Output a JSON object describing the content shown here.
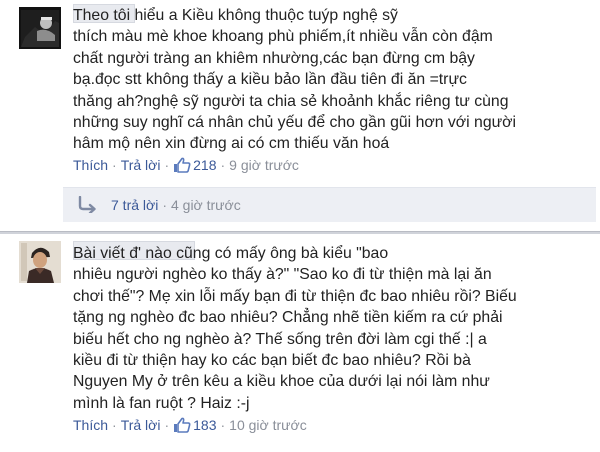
{
  "comments": [
    {
      "text": "Theo tôi hiểu a Kiều không thuộc tuýp nghệ sỹ\nthích màu mè khoe khoang phù phiếm,ít nhiều vẫn còn đậm\nchất người tràng an khiêm nhường,các bạn đừng cm bậy\nbạ.đọc stt không thấy a kiều bảo lần đầu tiên đi ăn =trực\nthăng ah?nghệ sỹ người ta chia sẻ khoảnh khắc riêng tư cùng\nnhững suy nghĩ cá nhân chủ yếu để cho gần gũi hơn với người\nhâm mộ nên xin đừng ai có cm thiếu văn hoá",
      "like_label": "Thích",
      "reply_label": "Trả lời",
      "like_count": "218",
      "time": "9 giờ trước",
      "like_icon": "thumbs-up-icon",
      "replies_summary": {
        "icon": "reply-arrow-icon",
        "count_label": "7 trả lời",
        "time": "4 giờ trước"
      }
    },
    {
      "text": "Bài viết đ' nào cũng có mấy ông bà kiểu \"bao\nnhiêu người nghèo ko thấy à?\" \"Sao ko đi từ thiện mà lại ăn\nchơi thế\"? Mẹ xin lỗi mấy bạn đi từ thiện đc bao nhiêu rồi? Biếu\ntặng ng nghèo đc bao nhiêu? Chẳng nhẽ tiền kiếm ra cứ phải\nbiếu hết cho ng nghèo à? Thế sống trên đời làm cgi thế :| a\nkiều đi từ thiện hay ko các bạn biết đc bao nhiêu? Rồi bà\nNguyen My ở trên kêu a kiều khoe của dưới lại nói làm như\nmình là fan ruột ? Haiz :-j",
      "like_label": "Thích",
      "reply_label": "Trả lời",
      "like_count": "183",
      "time": "10 giờ trước",
      "like_icon": "thumbs-up-icon"
    }
  ],
  "separator": "·",
  "colors": {
    "link": "#3b5998",
    "text": "#222222",
    "muted": "#8a8f99",
    "reply_bar": "#edeff4",
    "divider": "#b9bcc4"
  }
}
